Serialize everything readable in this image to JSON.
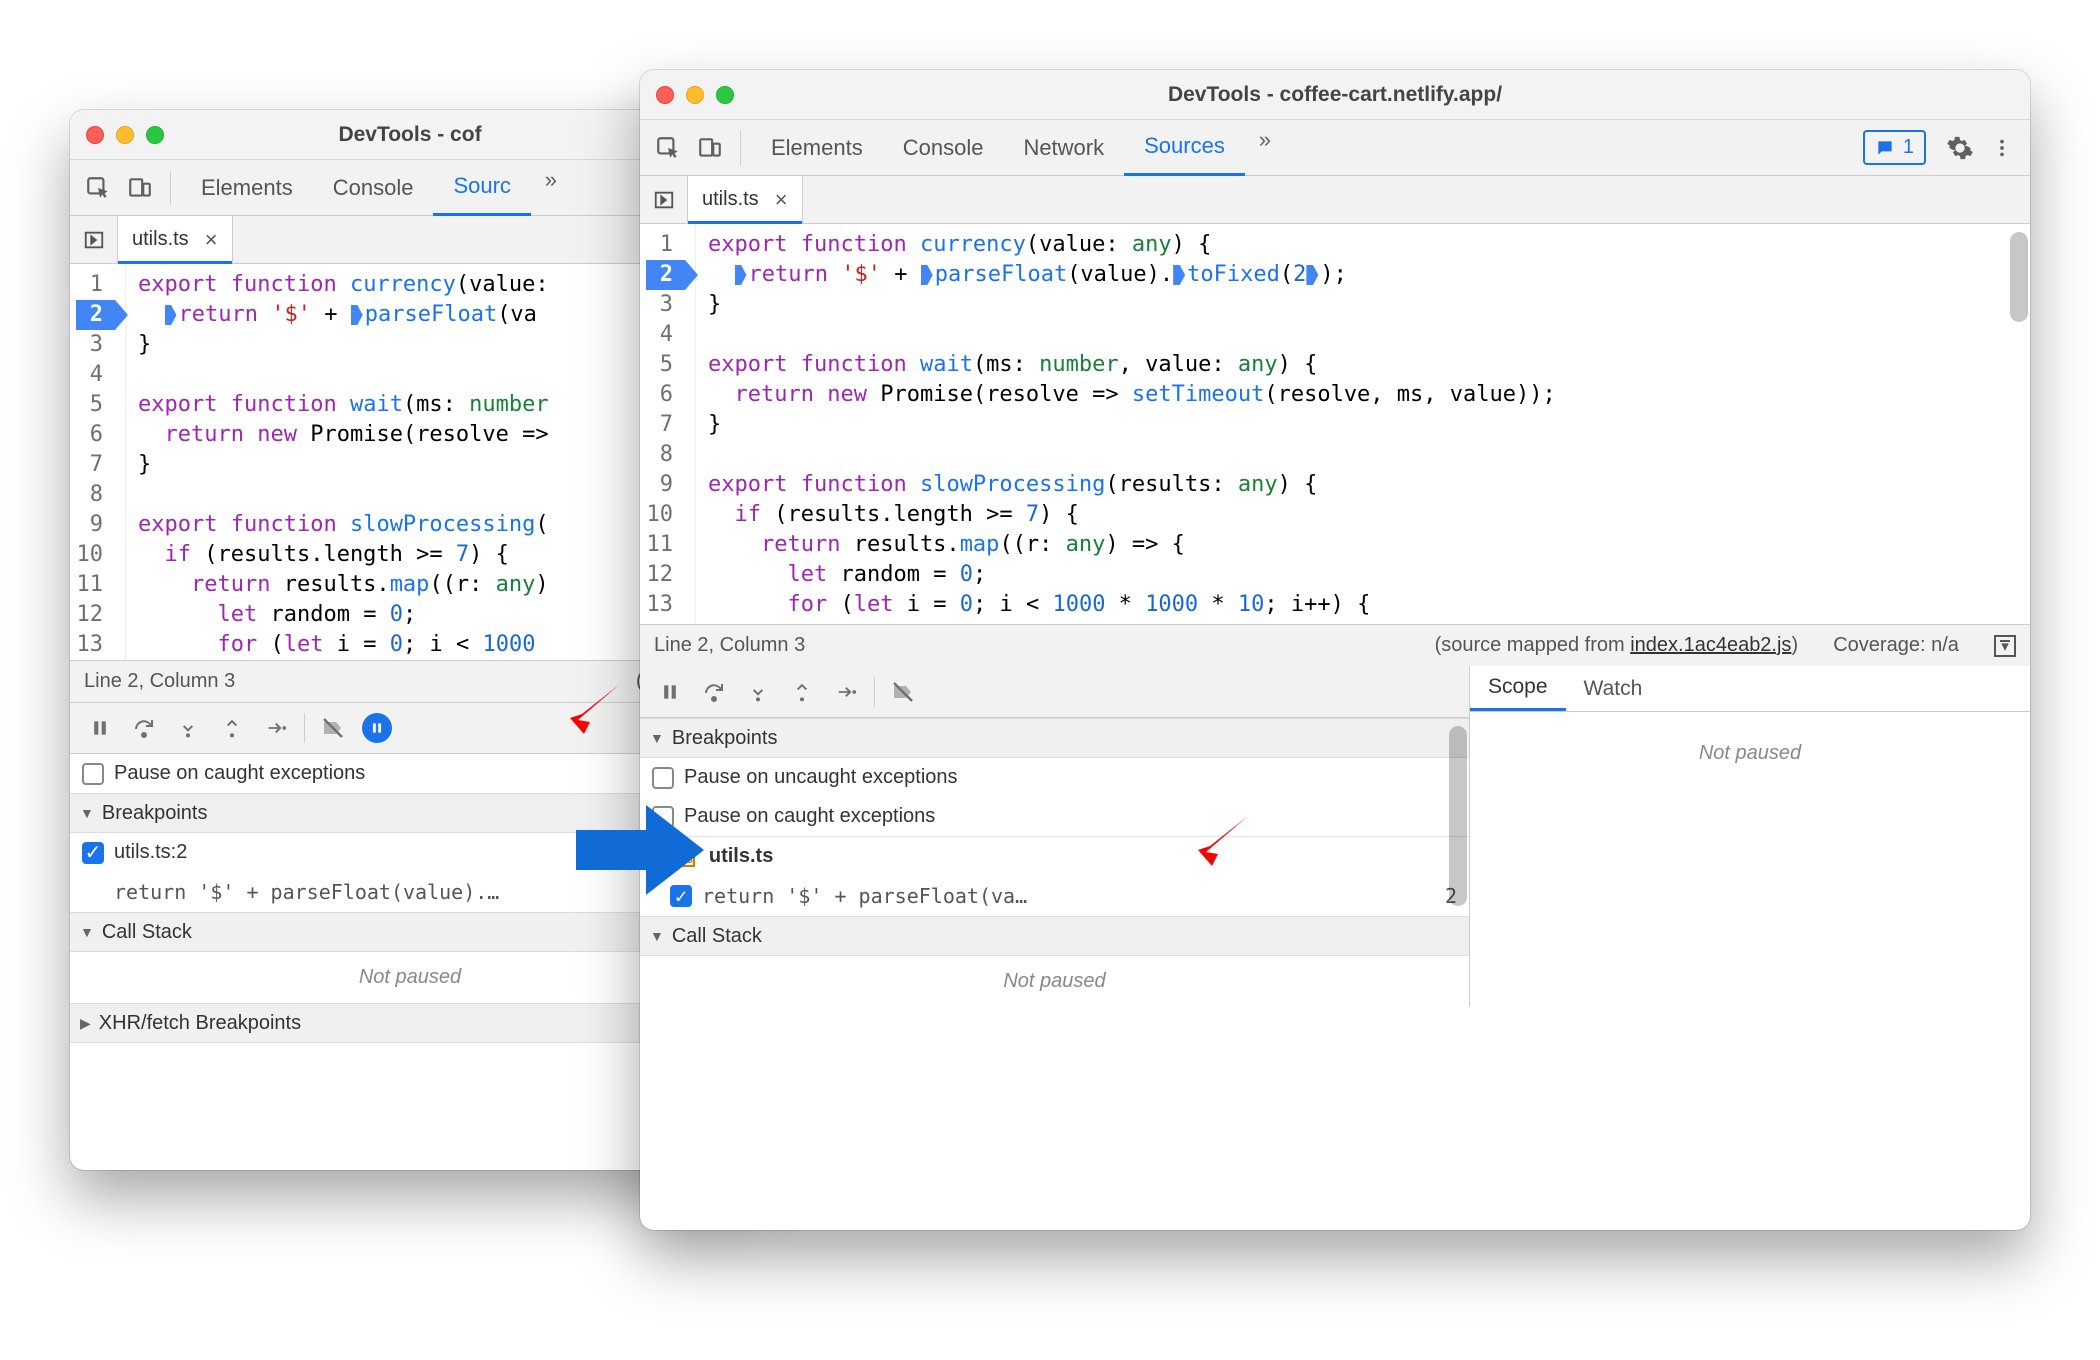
{
  "windowA": {
    "title": "DevTools - cof",
    "tabs": [
      "Elements",
      "Console",
      "Sourc",
      ">>"
    ],
    "activeTabIndex": 2,
    "tabbar": {
      "file": "utils.ts"
    },
    "code": {
      "lines": [
        {
          "n": 1,
          "html": "<span class='tok-kw'>export</span> <span class='tok-kw'>function</span> <span class='tok-fn'>currency</span>(<span>value:</span>"
        },
        {
          "n": 2,
          "bp": true,
          "html": "  <span class='step-marker'></span><span class='tok-kw'>return</span> <span class='tok-str'>'$'</span> + <span class='step-marker'></span><span class='tok-fn'>parseFloat</span>(va"
        },
        {
          "n": 3,
          "html": "}"
        },
        {
          "n": 4,
          "html": ""
        },
        {
          "n": 5,
          "html": "<span class='tok-kw'>export</span> <span class='tok-kw'>function</span> <span class='tok-fn'>wait</span>(ms: <span class='tok-type'>number</span>"
        },
        {
          "n": 6,
          "html": "  <span class='tok-kw'>return</span> <span class='tok-kw'>new</span> Promise(resolve =&gt;"
        },
        {
          "n": 7,
          "html": "}"
        },
        {
          "n": 8,
          "html": ""
        },
        {
          "n": 9,
          "html": "<span class='tok-kw'>export</span> <span class='tok-kw'>function</span> <span class='tok-fn'>slowProcessing</span>("
        },
        {
          "n": 10,
          "html": "  <span class='tok-kw'>if</span> (results.length &gt;= <span class='tok-num'>7</span>) {"
        },
        {
          "n": 11,
          "html": "    <span class='tok-kw'>return</span> results.<span class='tok-fn'>map</span>((r: <span class='tok-type'>any</span>)"
        },
        {
          "n": 12,
          "html": "      <span class='tok-kw'>let</span> random = <span class='tok-num'>0</span>;"
        },
        {
          "n": 13,
          "html": "      <span class='tok-kw'>for</span> (<span class='tok-kw'>let</span> i = <span class='tok-num'>0</span>; i &lt; <span class='tok-num'>1000</span>"
        }
      ]
    },
    "footer": {
      "pos": "Line 2, Column 3",
      "map": "(source ma"
    },
    "breakpoints_label": "Breakpoints",
    "caught_label": "Pause on caught exceptions",
    "bp_item": {
      "label": "utils.ts:2",
      "snippet": "return '$' + parseFloat(value).…"
    },
    "callstack_label": "Call Stack",
    "notpaused": "Not paused",
    "xhr_label": "XHR/fetch Breakpoints"
  },
  "windowB": {
    "title": "DevTools - coffee-cart.netlify.app/",
    "tabs": [
      "Elements",
      "Console",
      "Network",
      "Sources",
      ">>"
    ],
    "activeTabIndex": 3,
    "issues_count": "1",
    "tabbar": {
      "file": "utils.ts"
    },
    "code": {
      "lines": [
        {
          "n": 1,
          "html": "<span class='tok-kw'>export</span> <span class='tok-kw'>function</span> <span class='tok-fn'>currency</span>(<span>value</span>: <span class='tok-type'>any</span>) {"
        },
        {
          "n": 2,
          "bp": true,
          "html": "  <span class='step-marker'></span><span class='tok-kw'>return</span> <span class='tok-str'>'$'</span> + <span class='step-marker'></span><span class='tok-fn'>parseFloat</span>(value).<span class='step-marker'></span><span class='tok-fn'>toFixed</span>(<span class='tok-num'>2</span><span class='step-marker'></span>);"
        },
        {
          "n": 3,
          "html": "}"
        },
        {
          "n": 4,
          "html": ""
        },
        {
          "n": 5,
          "html": "<span class='tok-kw'>export</span> <span class='tok-kw'>function</span> <span class='tok-fn'>wait</span>(ms: <span class='tok-type'>number</span>, value: <span class='tok-type'>any</span>) {"
        },
        {
          "n": 6,
          "html": "  <span class='tok-kw'>return</span> <span class='tok-kw'>new</span> Promise(resolve =&gt; <span class='tok-fn'>setTimeout</span>(resolve, ms, value));"
        },
        {
          "n": 7,
          "html": "}"
        },
        {
          "n": 8,
          "html": ""
        },
        {
          "n": 9,
          "html": "<span class='tok-kw'>export</span> <span class='tok-kw'>function</span> <span class='tok-fn'>slowProcessing</span>(results: <span class='tok-type'>any</span>) {"
        },
        {
          "n": 10,
          "html": "  <span class='tok-kw'>if</span> (results.length &gt;= <span class='tok-num'>7</span>) {"
        },
        {
          "n": 11,
          "html": "    <span class='tok-kw'>return</span> results.<span class='tok-fn'>map</span>((r: <span class='tok-type'>any</span>) =&gt; {"
        },
        {
          "n": 12,
          "html": "      <span class='tok-kw'>let</span> random = <span class='tok-num'>0</span>;"
        },
        {
          "n": 13,
          "html": "      <span class='tok-kw'>for</span> (<span class='tok-kw'>let</span> i = <span class='tok-num'>0</span>; i &lt; <span class='tok-num'>1000</span> * <span class='tok-num'>1000</span> * <span class='tok-num'>10</span>; i++) {"
        }
      ]
    },
    "footer": {
      "pos": "Line 2, Column 3",
      "map_prefix": "(source mapped from ",
      "map_link": "index.1ac4eab2.js",
      "map_suffix": ")",
      "coverage": "Coverage: n/a"
    },
    "breakpoints_label": "Breakpoints",
    "uncaught_label": "Pause on uncaught exceptions",
    "caught_label": "Pause on caught exceptions",
    "bp_file": {
      "name": "utils.ts",
      "snippet": "return '$' + parseFloat(va…",
      "count": "2"
    },
    "callstack_label": "Call Stack",
    "notpaused": "Not paused",
    "scope_tab": "Scope",
    "watch_tab": "Watch"
  }
}
